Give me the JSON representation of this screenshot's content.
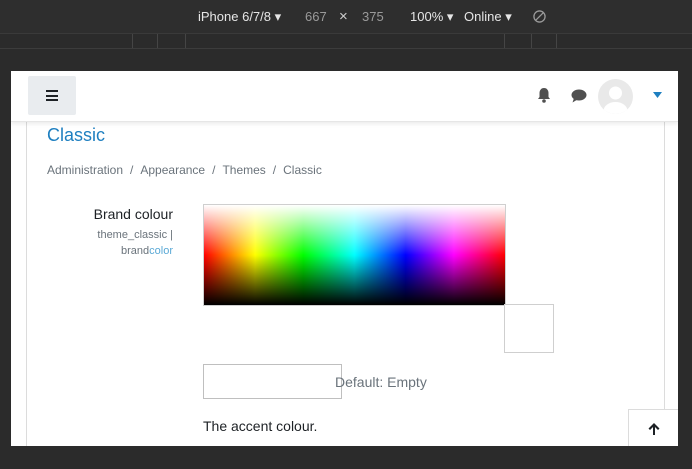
{
  "devtools": {
    "device": "iPhone 6/7/8",
    "width": "667",
    "times": "×",
    "height": "375",
    "zoom": "100%",
    "network": "Online"
  },
  "navbar": {
    "icons": [
      "menu-icon",
      "bell-icon",
      "chat-icon",
      "user-avatar",
      "caret-down-icon"
    ]
  },
  "page": {
    "title": "Classic",
    "breadcrumb": [
      "Administration",
      "Appearance",
      "Themes",
      "Classic"
    ],
    "breadcrumb_sep": "/"
  },
  "setting": {
    "label": "Brand colour",
    "id_prefix": "theme_classic |",
    "id_name": "brand",
    "id_highlight": "color",
    "input_value": "",
    "default_text": "Default: Empty",
    "description": "The accent colour."
  },
  "colors": {
    "accent": "#1e7fc0",
    "muted_text": "#6a737b",
    "highlight": "#5aa9d6"
  }
}
